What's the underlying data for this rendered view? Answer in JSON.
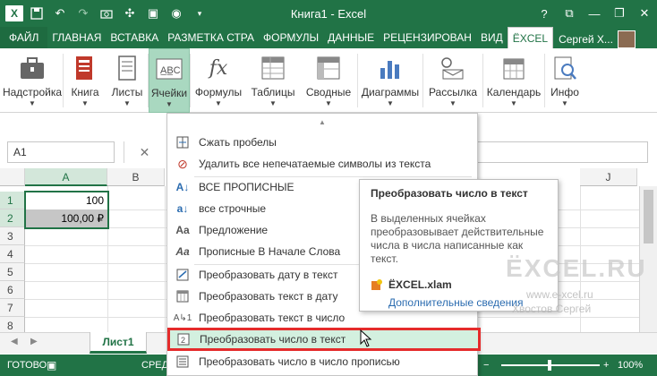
{
  "titlebar": {
    "title": "Книга1 - Excel",
    "app_logo": "X",
    "help": "?",
    "minimize": "—",
    "restore": "❐",
    "close": "✕",
    "ribbon_display": "⧉"
  },
  "tabs": [
    {
      "label": "ФАЙЛ"
    },
    {
      "label": "ГЛАВНАЯ"
    },
    {
      "label": "ВСТАВКА"
    },
    {
      "label": "РАЗМЕТКА СТРА"
    },
    {
      "label": "ФОРМУЛЫ"
    },
    {
      "label": "ДАННЫЕ"
    },
    {
      "label": "РЕЦЕНЗИРОВАН"
    },
    {
      "label": "ВИД"
    },
    {
      "label": "ЁXCEL"
    }
  ],
  "user": {
    "name": "Сергей Х..."
  },
  "ribbon": {
    "groups": [
      {
        "label": "Надстройка",
        "icon": "briefcase-icon"
      },
      {
        "label": "Книга",
        "icon": "book-icon"
      },
      {
        "label": "Листы",
        "icon": "sheets-icon"
      },
      {
        "label": "Ячейки",
        "icon": "cells-icon"
      },
      {
        "label": "Формулы",
        "icon": "fx-icon"
      },
      {
        "label": "Таблицы",
        "icon": "table-icon"
      },
      {
        "label": "Сводные",
        "icon": "pivot-icon"
      },
      {
        "label": "Диаграммы",
        "icon": "chart-icon"
      },
      {
        "label": "Рассылка",
        "icon": "mail-icon"
      },
      {
        "label": "Календарь",
        "icon": "calendar-icon"
      },
      {
        "label": "Инфо",
        "icon": "info-icon"
      }
    ],
    "arrow": "▼"
  },
  "formula_bar": {
    "name_box": "A1",
    "fx": "✕"
  },
  "grid": {
    "columns": [
      "A",
      "B",
      "C",
      "D",
      "E",
      "F",
      "G",
      "H",
      "I",
      "J"
    ],
    "rows": [
      "1",
      "2",
      "3",
      "4",
      "5",
      "6",
      "7",
      "8"
    ],
    "cells": {
      "A1": "100",
      "A2": "100,00 ₽"
    }
  },
  "sheet": {
    "active_tab": "Лист1"
  },
  "status": {
    "ready": "ГОТОВО",
    "avg": "СРЕД",
    "zoom": "100%"
  },
  "menu": {
    "items": [
      {
        "label": "Сжать пробелы",
        "icon": "compress-icon"
      },
      {
        "label": "Удалить все непечатаемые символы из текста",
        "icon": "erase-icon"
      },
      {
        "label": "ВСЕ ПРОПИСНЫЕ",
        "icon": "uppercase-icon"
      },
      {
        "label": "все строчные",
        "icon": "lowercase-icon"
      },
      {
        "label": "Предложение",
        "icon": "sentence-icon"
      },
      {
        "label": "Прописные В Начале Слова",
        "icon": "capitalize-icon"
      },
      {
        "label": "Преобразовать дату в текст",
        "icon": "date-text-icon"
      },
      {
        "label": "Преобразовать текст в дату",
        "icon": "text-date-icon"
      },
      {
        "label": "Преобразовать текст в число",
        "icon": "text-number-icon"
      },
      {
        "label": "Преобразовать число в текст",
        "icon": "number-text-icon"
      },
      {
        "label": "Преобразовать число в число прописью",
        "icon": "number-words-icon"
      }
    ]
  },
  "tooltip": {
    "title": "Преобразовать число в текст",
    "description": "В выделенных ячейках преобразовывает действительные числа в числа написанные как текст.",
    "addin": "ЁXCEL.xlam",
    "more": "Дополнительные сведения"
  },
  "watermark": {
    "logo": "ЁXCEL.RU",
    "url": "www.e-xcel.ru",
    "author": "Хвостов Сергей"
  },
  "colors": {
    "excel_green": "#217346",
    "highlight_red": "#e52b2b"
  }
}
